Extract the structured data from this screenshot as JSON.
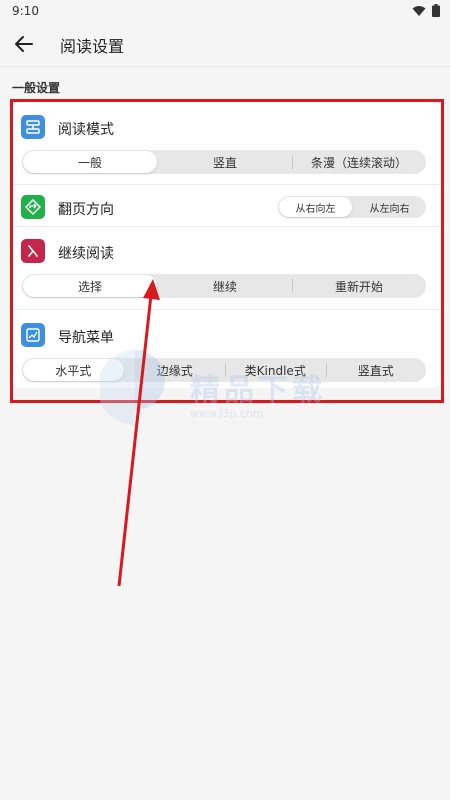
{
  "status_bar": {
    "time": "9:10"
  },
  "app_bar": {
    "title": "阅读设置"
  },
  "section": {
    "label": "一般设置"
  },
  "rows": [
    {
      "label": "阅读模式",
      "icon": "reading-mode-icon",
      "icon_color": "#3d8fe0",
      "options": [
        "一般",
        "竖直",
        "条漫（连续滚动）"
      ],
      "selected": 0
    },
    {
      "label": "翻页方向",
      "icon": "page-direction-icon",
      "icon_color": "#22b04a",
      "options": [
        "从右向左",
        "从左向右"
      ],
      "selected": 0
    },
    {
      "label": "继续阅读",
      "icon": "continue-reading-icon",
      "icon_color": "#c2284d",
      "options": [
        "选择",
        "继续",
        "重新开始"
      ],
      "selected": 0
    },
    {
      "label": "导航菜单",
      "icon": "navigation-menu-icon",
      "icon_color": "#3d8fe0",
      "options": [
        "水平式",
        "边缘式",
        "类Kindle式",
        "竖直式"
      ],
      "selected": 0
    }
  ],
  "watermark": {
    "text": "精品下载",
    "url": "www.j3p.com"
  },
  "colors": {
    "annotation": "#d8191e",
    "card": "#ffffff",
    "background": "#f5f5f5"
  }
}
